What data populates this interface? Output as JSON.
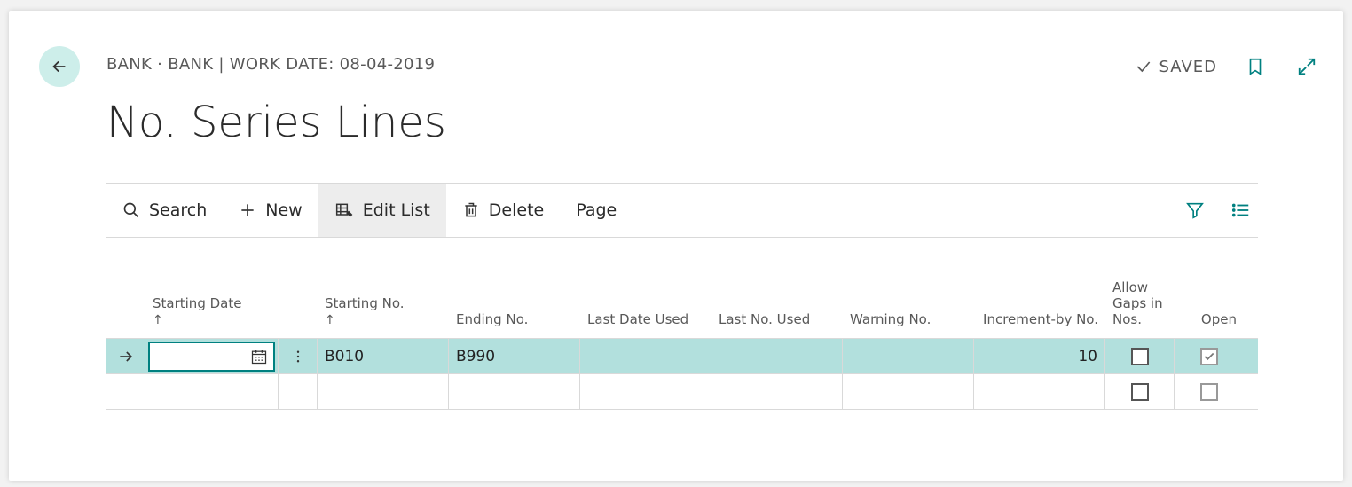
{
  "breadcrumb": "BANK · BANK | WORK DATE: 08-04-2019",
  "saved_label": "SAVED",
  "page_title": "No. Series Lines",
  "toolbar": {
    "search": "Search",
    "new": "New",
    "edit_list": "Edit List",
    "delete": "Delete",
    "page": "Page"
  },
  "columns": {
    "starting_date": "Starting Date",
    "starting_no": "Starting No.",
    "ending_no": "Ending No.",
    "last_date_used": "Last Date Used",
    "last_no_used": "Last No. Used",
    "warning_no": "Warning No.",
    "increment_by_no": "Increment-by No.",
    "allow_gaps": "Allow Gaps in Nos.",
    "open": "Open"
  },
  "rows": [
    {
      "starting_date": "",
      "starting_no": "B010",
      "ending_no": "B990",
      "last_date_used": "",
      "last_no_used": "",
      "warning_no": "",
      "increment_by_no": "10",
      "allow_gaps": false,
      "open": true,
      "selected": true
    },
    {
      "starting_date": "",
      "starting_no": "",
      "ending_no": "",
      "last_date_used": "",
      "last_no_used": "",
      "warning_no": "",
      "increment_by_no": "",
      "allow_gaps": false,
      "open": false,
      "selected": false
    }
  ]
}
